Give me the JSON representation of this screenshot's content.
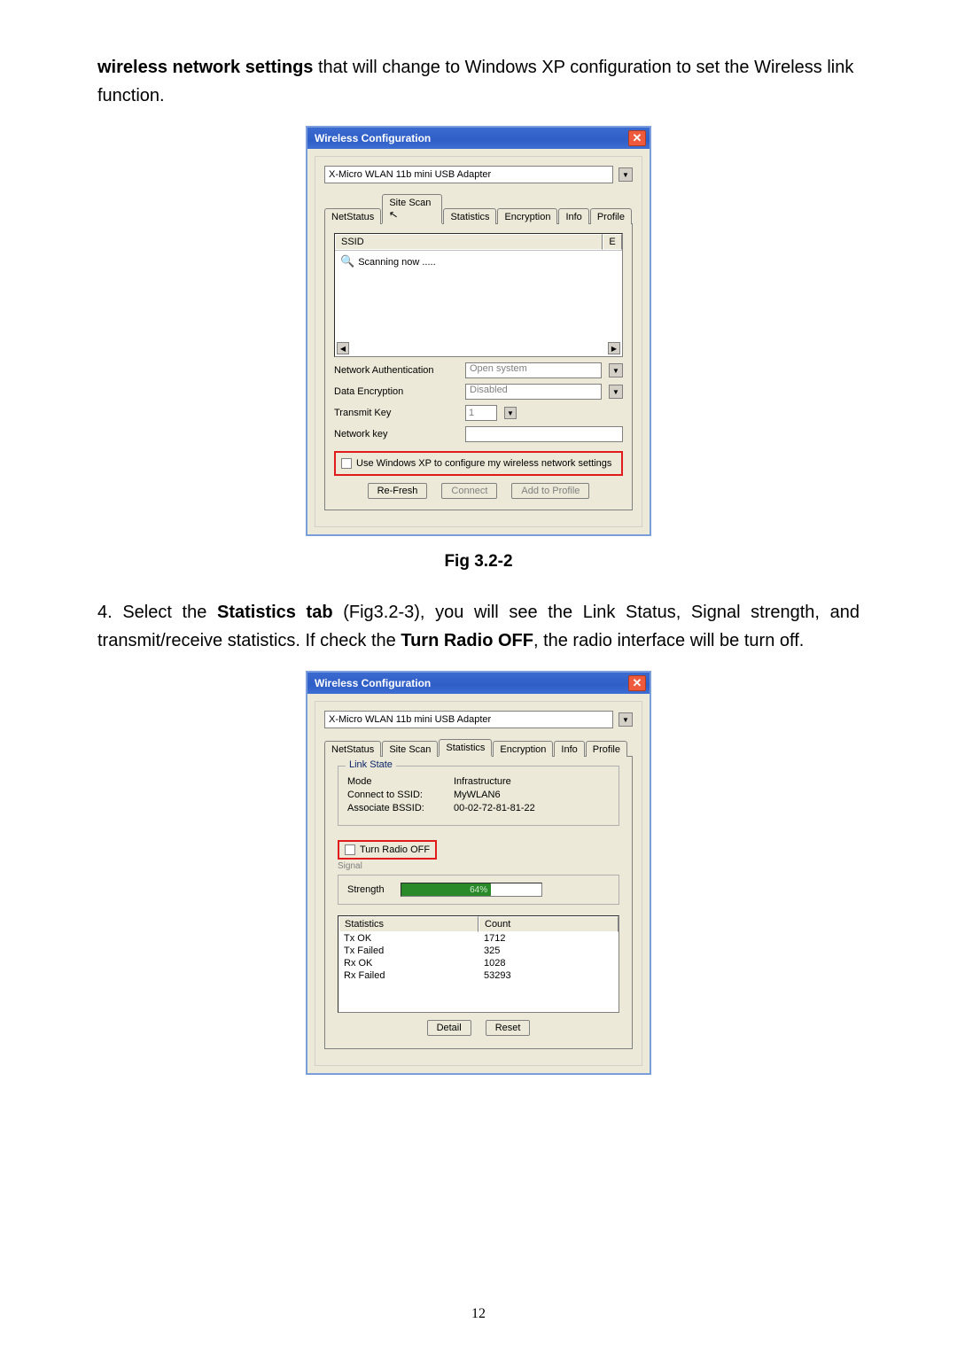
{
  "intro": {
    "line1_bold": "wireless network settings",
    "line1_rest": " that will change to Windows XP configuration to set the Wireless link function."
  },
  "fig1_caption": "Fig 3.2-2",
  "para2": {
    "prefix": "4. Select the ",
    "bold1": "Statistics tab",
    "mid": " (Fig3.2-3), you will see the Link Status, Signal strength, and transmit/receive statistics. If check the ",
    "bold2": "Turn Radio OFF",
    "suffix": ", the radio interface will be turn off."
  },
  "page_number": "12",
  "dialog": {
    "title": "Wireless Configuration",
    "adapter": "X-Micro WLAN 11b mini USB Adapter",
    "tabs": {
      "netstatus": "NetStatus",
      "sitescan": "Site Scan",
      "statistics": "Statistics",
      "encryption": "Encryption",
      "info": "Info",
      "profile": "Profile"
    }
  },
  "sitescan": {
    "columns": {
      "ssid": "SSID",
      "e": "E"
    },
    "scanning": "Scanning now .....",
    "labels": {
      "netauth": "Network Authentication",
      "dataenc": "Data Encryption",
      "txkey": "Transmit Key",
      "netkey": "Network key"
    },
    "values": {
      "netauth": "Open system",
      "dataenc": "Disabled",
      "txkey": "1"
    },
    "usexp": "Use Windows XP to configure my wireless network settings",
    "buttons": {
      "refresh": "Re-Fresh",
      "connect": "Connect",
      "add": "Add to Profile"
    }
  },
  "stats": {
    "linkstate_legend": "Link State",
    "mode_k": "Mode",
    "mode_v": "Infrastructure",
    "ssid_k": "Connect to SSID:",
    "ssid_v": "MyWLAN6",
    "bssid_k": "Associate BSSID:",
    "bssid_v": "00-02-72-81-81-22",
    "turnoff": "Turn Radio OFF",
    "signal_legend": "Signal",
    "strength_label": "Strength",
    "strength_pct": "64%",
    "table": {
      "h1": "Statistics",
      "h2": "Count",
      "rows": [
        {
          "k": "Tx OK",
          "v": "1712"
        },
        {
          "k": "Tx Failed",
          "v": "325"
        },
        {
          "k": "Rx OK",
          "v": "1028"
        },
        {
          "k": "Rx Failed",
          "v": "53293"
        }
      ]
    },
    "buttons": {
      "detail": "Detail",
      "reset": "Reset"
    }
  }
}
